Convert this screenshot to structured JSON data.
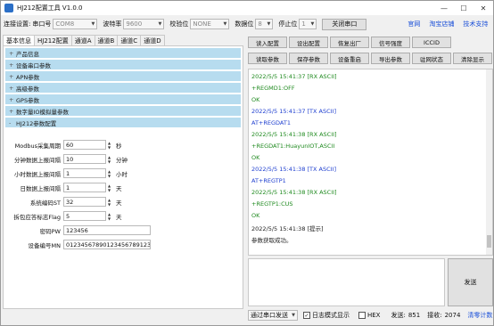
{
  "window": {
    "title": "HJ212配置工具 V1.0.0",
    "min": "—",
    "max": "☐",
    "close": "✕"
  },
  "toolbar": {
    "conn_label": "连接设置:",
    "port_label": "串口号",
    "port_value": "COM8",
    "baud_label": "波特率",
    "baud_value": "9600",
    "parity_label": "校验位",
    "parity_value": "NONE",
    "databits_label": "数据位",
    "databits_value": "8",
    "stopbits_label": "停止位",
    "stopbits_value": "1",
    "close_port": "关闭串口",
    "links": [
      "官网",
      "淘宝店铺",
      "技术支持"
    ]
  },
  "tabs": [
    "基本信息",
    "HJ212配置",
    "通道A",
    "通道B",
    "通道C",
    "通道D"
  ],
  "sections": [
    {
      "sign": "+",
      "label": "产品信息"
    },
    {
      "sign": "+",
      "label": "设备串口参数"
    },
    {
      "sign": "+",
      "label": "APN参数"
    },
    {
      "sign": "+",
      "label": "高级参数"
    },
    {
      "sign": "+",
      "label": "GPS参数"
    },
    {
      "sign": "+",
      "label": "数字量IO模拟量参数"
    },
    {
      "sign": "-",
      "label": "HJ212参数配置"
    }
  ],
  "fields": [
    {
      "label": "Modbus采集周期",
      "value": "60",
      "unit": "秒"
    },
    {
      "label": "分钟数据上报间隔",
      "value": "10",
      "unit": "分钟"
    },
    {
      "label": "小时数据上报间隔",
      "value": "1",
      "unit": "小时"
    },
    {
      "label": "日数据上报间隔",
      "value": "1",
      "unit": "天"
    },
    {
      "label": "系统编码ST",
      "value": "32",
      "unit": "天"
    },
    {
      "label": "拆包应答标志Flag",
      "value": "5",
      "unit": "天"
    },
    {
      "label": "密码PW",
      "value": "123456",
      "unit": ""
    },
    {
      "label": "设备编号MN",
      "value": "01234567890123456789​1234",
      "unit": ""
    }
  ],
  "commands": [
    "读入配置",
    "设出配置",
    "恢复出厂",
    "信号强度",
    "ICCID",
    "读取参数",
    "保存参数",
    "设备重启",
    "导出参数",
    "驻网状态",
    "清除显示"
  ],
  "log": [
    {
      "type": "rx",
      "text": "2022/5/5 15:41:37 [RX ASCII]"
    },
    {
      "type": "rx",
      "text": "+REGMD1:OFF"
    },
    {
      "type": "rx",
      "text": "OK"
    },
    {
      "type": "tx",
      "text": "2022/5/5 15:41:37 [TX ASCII]"
    },
    {
      "type": "tx",
      "text": "AT+REGDAT1"
    },
    {
      "type": "rx",
      "text": "2022/5/5 15:41:38 [RX ASCII]"
    },
    {
      "type": "rx",
      "text": "+REGDAT1:HuayunIOT,ASCII"
    },
    {
      "type": "rx",
      "text": "OK"
    },
    {
      "type": "tx",
      "text": "2022/5/5 15:41:38 [TX ASCII]"
    },
    {
      "type": "tx",
      "text": "AT+REGTP1"
    },
    {
      "type": "rx",
      "text": "2022/5/5 15:41:38 [RX ASCII]"
    },
    {
      "type": "rx",
      "text": "+REGTP1:CUS"
    },
    {
      "type": "rx",
      "text": "OK"
    },
    {
      "type": "info",
      "text": "2022/5/5 15:41:38 [提示]"
    },
    {
      "type": "info",
      "text": "参数获取成功。"
    }
  ],
  "send": {
    "button": "发送",
    "mode": "通过串口发送",
    "log_mode": "日志模式显示",
    "log_checked": "✓",
    "hex": "HEX",
    "sent_label": "发送:",
    "sent_value": "851",
    "recv_label": "接收:",
    "recv_value": "2074",
    "clear_count": "清零计数"
  },
  "colors": {
    "rx": "#1f8a1f",
    "tx": "#2040d0",
    "section": "#b7dcef",
    "link": "#1a4fd8"
  }
}
